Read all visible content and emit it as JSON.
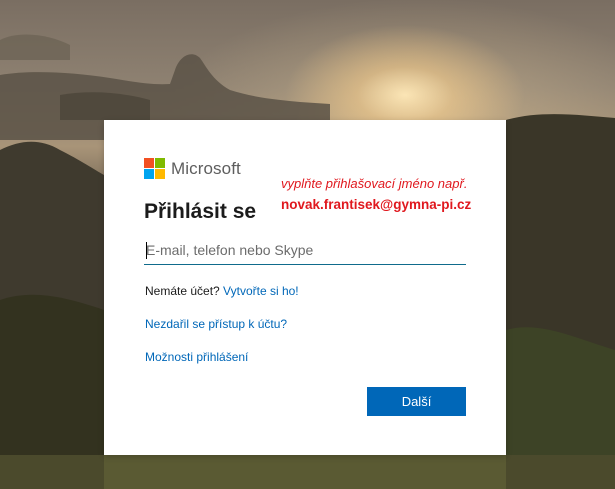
{
  "brand": {
    "name": "Microsoft",
    "logo_colors": [
      "#f25022",
      "#7fba00",
      "#00a4ef",
      "#ffb900"
    ]
  },
  "signin": {
    "title": "Přihlásit se",
    "email_placeholder": "E-mail, telefon nebo Skype",
    "email_value": "",
    "no_account_text": "Nemáte účet?",
    "create_account_link": "Vytvořte si ho!",
    "trouble_link": "Nezdařil se přístup k účtu?",
    "options_link": "Možnosti přihlášení",
    "next_button": "Další"
  },
  "annotation": {
    "line1": "vyplňte přihlašovací jméno např.",
    "line2": "novak.frantisek@gymna-pi.cz",
    "color": "#e0181e"
  },
  "colors": {
    "accent": "#0067b8",
    "card_bg": "#ffffff"
  }
}
